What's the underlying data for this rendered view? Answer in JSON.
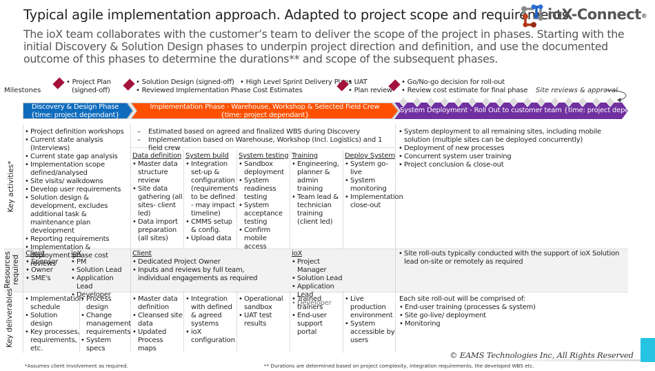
{
  "header": {
    "title": "Typical agile implementation approach. Adapted to project scope and requirements",
    "subtitle": "The ioX team collaborates with the customer’s team to deliver the scope of the project in phases. Starting with the initial Discovery & Solution Design phases to underpin project direction and definition, and use the documented outcome of this phases to determine the durations** and scope of the subsequent phases."
  },
  "logo": {
    "text": "ioX-Connect",
    "registered": "®"
  },
  "colors": {
    "discovery": "#0f6cbd",
    "implementation": "#fe5000",
    "deployment": "#7030a0",
    "milestone": "#a3123a",
    "accent": "#27c3e3"
  },
  "milestones": {
    "label": "Milestones",
    "m1": [
      "• Project Plan",
      "(signed-off)"
    ],
    "m2": [
      "• Solution Design (signed-off)",
      "• Reviewed Implementation Phase Cost Estimates"
    ],
    "m2_side": "• High Level Sprint Delivery Plans",
    "m3": [
      "• UAT",
      "• Plan review"
    ],
    "m4": [
      "• Go/No-go decision for roll-out",
      "• Review cost estimate for final phase"
    ],
    "site_reviews": "Site reviews & approval"
  },
  "phases": {
    "discovery": [
      "Discovery & Design Phase",
      "{time: project dependant}"
    ],
    "implementation": [
      "Implementation Phase - Warehouse, Workshop & Selected Field Crew",
      "{time: project dependant}"
    ],
    "deployment": "System Deployment - Roll Out to customer team {time: project dependant}"
  },
  "rows": {
    "activities": "Key activities*",
    "resources": [
      "Resources",
      "required"
    ],
    "deliverables": "Key deliverables"
  },
  "activities": {
    "discovery": [
      "Project definition workshops",
      "Current state analysis (Interviews)",
      "Current state gap analysis",
      "Implementation scope defined/analysed",
      "Site visits/ walkdowns",
      "Develop user requirements",
      "Solution design & development, excludes additional task & maintenance plan development",
      "Reporting requirements",
      "Implementation & deployment phase cost reviews"
    ],
    "impl_notes": [
      "Estimated based on agreed and finalized WBS during Discovery",
      "Implementation based on Warehouse, Workshop (Incl. Logistics) and 1 field crew"
    ],
    "columns": [
      {
        "heading": "Data definition",
        "items": [
          "Master data structure review",
          "Site data gathering (all sites- client led)",
          "Data import preparation (all sites)"
        ]
      },
      {
        "heading": "System build",
        "items": [
          "Integration set-up & configuration (requirements to be defined - may impact timeline)",
          "CMMS setup & config.",
          "Upload data"
        ]
      },
      {
        "heading": "System testing",
        "items": [
          "Sandbox deployment",
          "System readiness testing",
          "System acceptance testing",
          "Confirm mobile access"
        ]
      },
      {
        "heading": "Training",
        "items": [
          "Engineering, planner & admin training",
          "Team lead & technician training (client led)"
        ]
      },
      {
        "heading": "Deploy System",
        "items": [
          "System go-live",
          "System monitoring",
          "Implementation close-out"
        ]
      }
    ],
    "deployment": [
      "System deployment to all remaining sites, including mobile solution (multiple sites can be deployed concurrently)",
      "Deployment of new processes",
      "Concurrent system user training",
      "Project conclusion & close-out"
    ]
  },
  "resources": {
    "disc_client": {
      "heading": "Client",
      "items": [
        "Sponsor",
        "Owner",
        "SME's"
      ]
    },
    "disc_iox": {
      "heading": "ioX",
      "items": [
        "PM",
        "Solution Lead",
        "Application Lead",
        "Developer"
      ]
    },
    "impl_client": {
      "heading": "Client",
      "items": [
        "Dedicated Project Owner",
        "Inputs and reviews by full team, individual engagements as required"
      ]
    },
    "impl_iox": {
      "heading": "ioX",
      "items": [
        "Project Manager",
        "Solution Lead",
        "Application Lead"
      ],
      "muted_item": "Developer"
    },
    "deployment": [
      "Site roll-outs typically conducted with the support of ioX Solution lead on-site or remotely as required"
    ]
  },
  "deliverables": {
    "d1": [
      "Implementation schedule",
      "Solution design",
      "Key processes, requirements, etc."
    ],
    "d2": [
      "Process design",
      "Change management requirements",
      "System specs"
    ],
    "d3": [
      "Master data definition",
      "Cleansed site data",
      "Updated Process maps"
    ],
    "d4": [
      "Integration with defined & agreed systems",
      "ioX configuration"
    ],
    "d5": [
      "Operational sandbox",
      "UAT test results"
    ],
    "d6": [
      "Trained trainers",
      "End-user support portal"
    ],
    "d7": [
      "Live production environment",
      "System accessible by users"
    ],
    "deployment_intro": "Each site roll-out will be comprised of:",
    "deployment": [
      "End-user training (processes & system)",
      "Site go-live/ deployment",
      "Monitoring"
    ]
  },
  "footer": {
    "copyright": "© EAMS Technologies Inc, All Rights Reserved",
    "note_left": "*Assumes client involvement as required.",
    "note_right": "** Durations are determined based on project complexity, integration requirements, the developed WBS etc."
  }
}
